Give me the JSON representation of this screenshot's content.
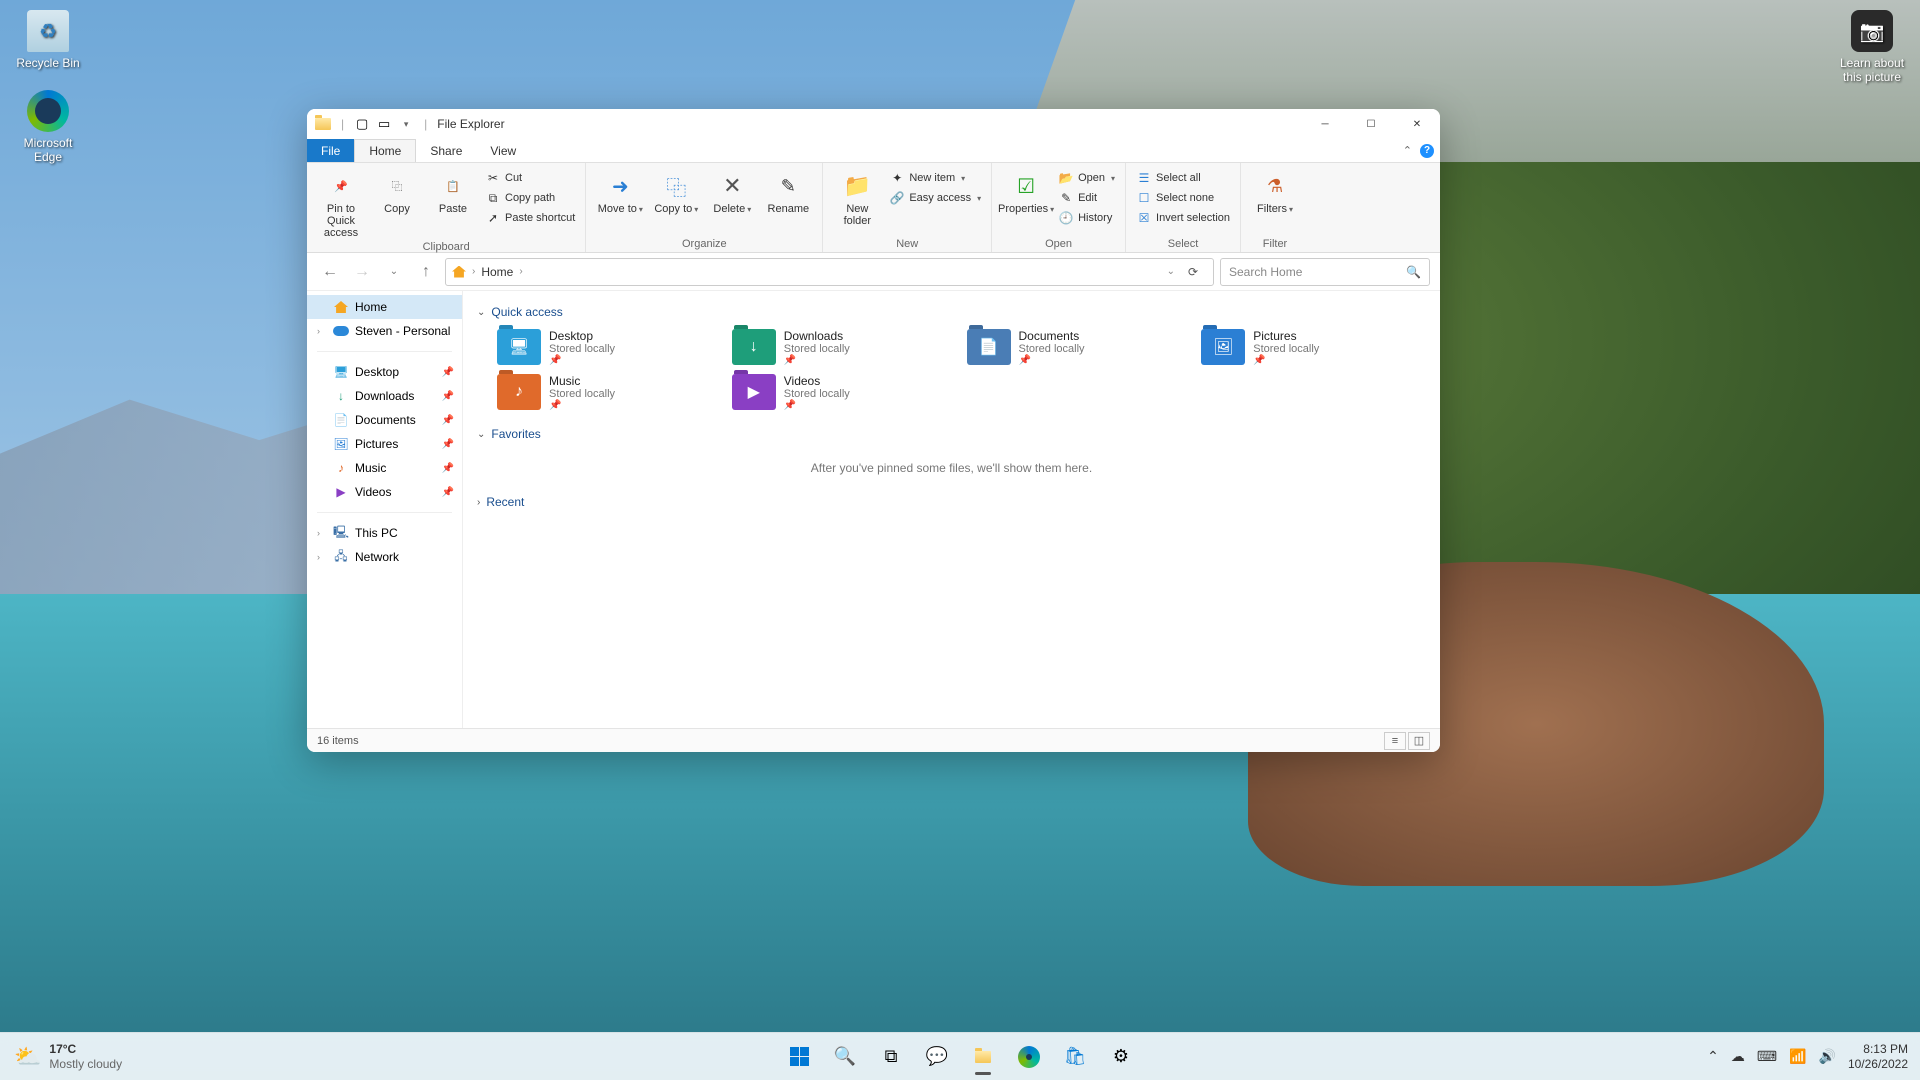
{
  "desktop": {
    "recycle": "Recycle Bin",
    "edge": "Microsoft Edge",
    "learn": "Learn about this picture"
  },
  "window": {
    "title": "File Explorer",
    "tabs": {
      "file": "File",
      "home": "Home",
      "share": "Share",
      "view": "View"
    },
    "ribbon": {
      "clipboard": {
        "label": "Clipboard",
        "pin": "Pin to Quick access",
        "copy": "Copy",
        "paste": "Paste",
        "cut": "Cut",
        "copypath": "Copy path",
        "pasteshortcut": "Paste shortcut"
      },
      "organize": {
        "label": "Organize",
        "move": "Move to",
        "copy": "Copy to",
        "delete": "Delete",
        "rename": "Rename"
      },
      "new": {
        "label": "New",
        "newfolder": "New folder",
        "newitem": "New item",
        "easy": "Easy access"
      },
      "open": {
        "label": "Open",
        "properties": "Properties",
        "open": "Open",
        "edit": "Edit",
        "history": "History"
      },
      "select": {
        "label": "Select",
        "all": "Select all",
        "none": "Select none",
        "invert": "Invert selection"
      },
      "filter": {
        "label": "Filter",
        "filters": "Filters"
      }
    },
    "addr": {
      "home": "Home"
    },
    "search": {
      "placeholder": "Search Home"
    },
    "sidebar": {
      "home": "Home",
      "onedrive": "Steven - Personal",
      "desktop": "Desktop",
      "downloads": "Downloads",
      "documents": "Documents",
      "pictures": "Pictures",
      "music": "Music",
      "videos": "Videos",
      "thispc": "This PC",
      "network": "Network"
    },
    "sections": {
      "quick": "Quick access",
      "favorites": "Favorites",
      "recent": "Recent",
      "fav_empty": "After you've pinned some files, we'll show them here."
    },
    "quick_items": [
      {
        "name": "Desktop",
        "sub": "Stored locally",
        "color": "#2b9fd9",
        "glyph": "🖥"
      },
      {
        "name": "Downloads",
        "sub": "Stored locally",
        "color": "#1e9e7a",
        "glyph": "↓"
      },
      {
        "name": "Documents",
        "sub": "Stored locally",
        "color": "#4a7db5",
        "glyph": "📄"
      },
      {
        "name": "Pictures",
        "sub": "Stored locally",
        "color": "#2b7fd4",
        "glyph": "🖼"
      },
      {
        "name": "Music",
        "sub": "Stored locally",
        "color": "#e06a2b",
        "glyph": "♪"
      },
      {
        "name": "Videos",
        "sub": "Stored locally",
        "color": "#8a3fc4",
        "glyph": "▶"
      }
    ],
    "status": {
      "count": "16 items"
    }
  },
  "taskbar": {
    "temp": "17°C",
    "cond": "Mostly cloudy",
    "time": "8:13 PM",
    "date": "10/26/2022"
  }
}
